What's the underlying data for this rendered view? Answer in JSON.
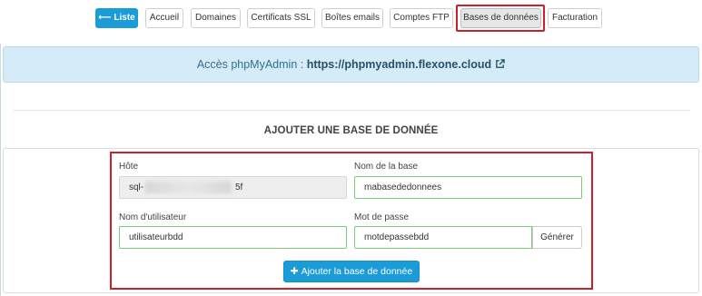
{
  "nav": {
    "items": [
      {
        "label": "⟵ Liste",
        "primary": true
      },
      {
        "label": "Accueil"
      },
      {
        "label": "Domaines"
      },
      {
        "label": "Certificats SSL"
      },
      {
        "label": "Boîtes emails"
      },
      {
        "label": "Comptes FTP"
      },
      {
        "label": "Bases de données",
        "active": true
      },
      {
        "label": "Facturation"
      }
    ]
  },
  "info": {
    "prefix": "Accès phpMyAdmin : ",
    "link": "https://phpmyadmin.flexone.cloud",
    "icon": "external-link-icon"
  },
  "section": {
    "title": "AJOUTER UNE BASE DE DONNÉE"
  },
  "form": {
    "host": {
      "label": "Hôte",
      "value_start": "sql-",
      "value_end": "5f"
    },
    "dbname": {
      "label": "Nom de la base",
      "value": "mabasededonnees"
    },
    "user": {
      "label": "Nom d'utilisateur",
      "value": "utilisateurbdd"
    },
    "password": {
      "label": "Mot de passe",
      "value": "motdepassebdd"
    },
    "generate_label": "Générer",
    "submit_label": "Ajouter la base de donnée",
    "submit_icon": "plus-icon"
  },
  "colors": {
    "primary": "#1b9bd7",
    "info_bg": "#d5ebf7",
    "highlight": "#c9202f",
    "valid_border": "#7cc97c"
  }
}
